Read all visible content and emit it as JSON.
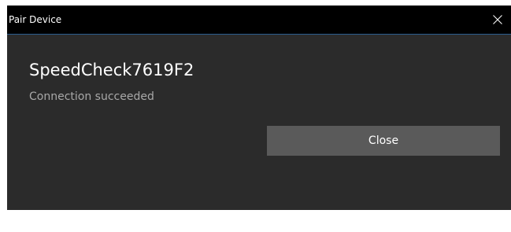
{
  "dialog": {
    "title": "Pair Device",
    "device_name": "SpeedCheck7619F2",
    "status": "Connection succeeded",
    "close_button_label": "Close",
    "close_icon": "close-icon"
  },
  "colors": {
    "titlebar_bg": "#000000",
    "body_bg": "#2b2b2b",
    "accent_line": "#2a5d8f",
    "button_bg": "#5a5a5a",
    "status_text": "#a8a8a8"
  }
}
